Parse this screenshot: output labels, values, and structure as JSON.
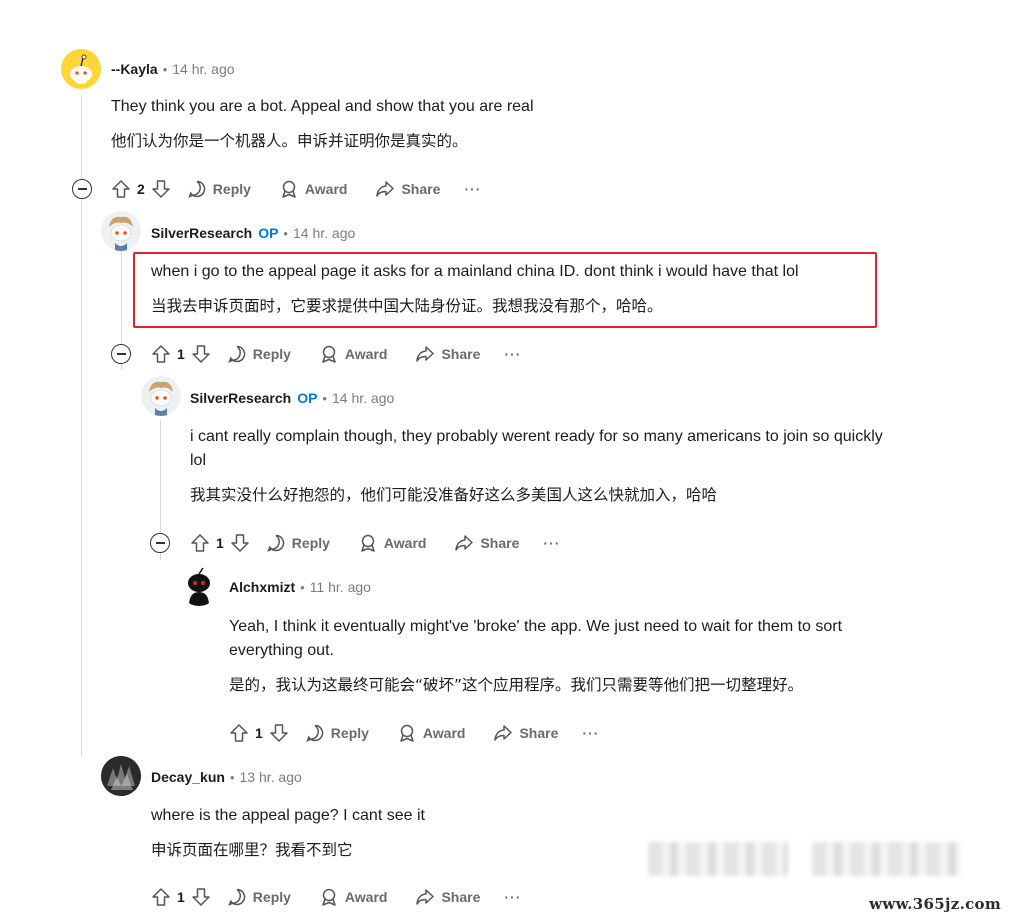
{
  "comments": [
    {
      "username": "--Kayla",
      "op": false,
      "time": "14 hr. ago",
      "en": "They think you are a bot. Appeal and show that you are real",
      "zh": "他们认为你是一个机器人。申诉并证明你是真实的。",
      "votes": "2",
      "actions": {
        "reply": "Reply",
        "award": "Award",
        "share": "Share",
        "more": "···"
      }
    },
    {
      "username": "SilverResearch",
      "op": true,
      "op_label": "OP",
      "time": "14 hr. ago",
      "en": "when i go to the appeal page it asks for a mainland china ID. dont think i would have that lol",
      "zh": "当我去申诉页面时，它要求提供中国大陆身份证。我想我没有那个，哈哈。",
      "votes": "1",
      "actions": {
        "reply": "Reply",
        "award": "Award",
        "share": "Share",
        "more": "···"
      }
    },
    {
      "username": "SilverResearch",
      "op": true,
      "op_label": "OP",
      "time": "14 hr. ago",
      "en1": "i cant really complain though, they probably werent ready for so many americans to join so quickly",
      "en2": "lol",
      "zh": "我其实没什么好抱怨的，他们可能没准备好这么多美国人这么快就加入，哈哈",
      "votes": "1",
      "actions": {
        "reply": "Reply",
        "award": "Award",
        "share": "Share",
        "more": "···"
      }
    },
    {
      "username": "Alchxmizt",
      "op": false,
      "time": "11 hr. ago",
      "en1": "Yeah, I think it eventually might've 'broke' the app. We just need to wait for them to sort",
      "en2": "everything out.",
      "zh": "是的，我认为这最终可能会“破坏”这个应用程序。我们只需要等他们把一切整理好。",
      "votes": "1",
      "actions": {
        "reply": "Reply",
        "award": "Award",
        "share": "Share",
        "more": "···"
      }
    },
    {
      "username": "Decay_kun",
      "op": false,
      "time": "13 hr. ago",
      "en": "where is the appeal page? I cant see it",
      "zh": "申诉页面在哪里？我看不到它",
      "votes": "1",
      "actions": {
        "reply": "Reply",
        "award": "Award",
        "share": "Share",
        "more": "···"
      }
    }
  ],
  "separator": "•",
  "watermark": "www.365jz.com",
  "colors": {
    "op": "#0079d3",
    "highlight": "#e02424",
    "meta": "#7c7c7c"
  },
  "icons": [
    "upvote-icon",
    "downvote-icon",
    "reply-bubble-icon",
    "award-icon",
    "share-icon",
    "collapse-icon",
    "more-icon"
  ]
}
